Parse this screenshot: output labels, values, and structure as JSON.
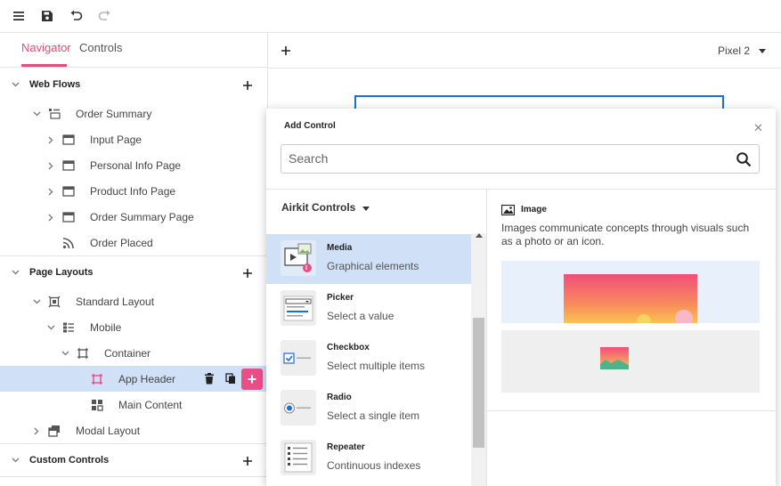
{
  "toolbar": {
    "menu_icon": "menu-icon",
    "save_icon": "save-icon",
    "undo_icon": "undo-icon",
    "redo_icon": "redo-icon"
  },
  "navigator": {
    "tabs": [
      {
        "label": "Navigator",
        "active": true
      },
      {
        "label": "Controls",
        "active": false
      }
    ],
    "accent_color": "#e24e77",
    "sections": {
      "web_flows": "Web Flows",
      "page_layouts": "Page Layouts",
      "custom_controls": "Custom Controls"
    },
    "web_flows": {
      "order_summary": "Order Summary",
      "pages": [
        "Input Page",
        "Personal Info Page",
        "Product Info Page",
        "Order Summary Page",
        "Order Placed"
      ]
    },
    "page_layouts": {
      "standard_layout": "Standard Layout",
      "mobile": "Mobile",
      "container": "Container",
      "app_header": "App Header",
      "main_content": "Main Content",
      "modal_layout": "Modal Layout"
    }
  },
  "canvas": {
    "device": "Pixel 2"
  },
  "add_control": {
    "title": "Add Control",
    "search_placeholder": "Search",
    "search_value": "",
    "library": "Airkit Controls",
    "items": [
      {
        "name": "Media",
        "desc": "Graphical elements",
        "selected": true
      },
      {
        "name": "Picker",
        "desc": "Select a value",
        "selected": false
      },
      {
        "name": "Checkbox",
        "desc": "Select multiple items",
        "selected": false
      },
      {
        "name": "Radio",
        "desc": "Select a single item",
        "selected": false
      },
      {
        "name": "Repeater",
        "desc": "Continuous indexes",
        "selected": false
      }
    ],
    "preview": {
      "title": "Image",
      "desc": "Images communicate concepts through visuals such as a photo or an icon."
    }
  }
}
